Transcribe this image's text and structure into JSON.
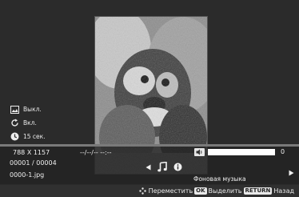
{
  "settings": {
    "slideshow_effect": "Выкл.",
    "repeat": "Вкл.",
    "interval": "15 сек."
  },
  "info": {
    "resolution": "788 X 1157",
    "datetime": "--/--/-- --:--",
    "index": "00001 / 00004",
    "filename": "0000-1.jpg",
    "volume_value": "0",
    "bg_music_label": "Фоновая музыка"
  },
  "icons": {
    "prev": "triangle-left-icon",
    "music": "music-note-icon",
    "info": "info-icon",
    "volume": "speaker-icon",
    "next": "triangle-right-icon"
  },
  "volume_level": 1.0,
  "help": {
    "move": "Переместить",
    "ok_key": "OK",
    "select": "Выделить",
    "return_key": "RETURN",
    "back": "Назад"
  }
}
